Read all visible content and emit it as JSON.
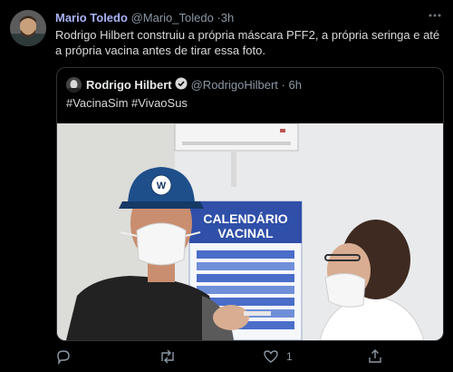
{
  "tweet": {
    "author_name": "Mario Toledo",
    "author_handle": "@Mario_Toledo",
    "separator": "·",
    "time": "3h",
    "text": "Rodrigo Hilbert construiu a própria máscara PFF2, a própria seringa e até a própria vacina antes de tirar essa foto."
  },
  "quoted_tweet": {
    "author_name": "Rodrigo Hilbert",
    "author_handle": "@RodrigoHilbert",
    "separator": "·",
    "time": "6h",
    "text": "#VacinaSim #VivaoSus",
    "image": {
      "poster_title_line1": "CALENDÁRIO",
      "poster_title_line2": "VACINAL",
      "cap_logo": "W"
    }
  },
  "actions": {
    "like_count": "1"
  },
  "icons": [
    "more-icon",
    "verified-icon",
    "reply-icon",
    "retweet-icon",
    "like-icon",
    "share-icon"
  ],
  "colors": {
    "author_name": "#a9b4f7",
    "muted": "#8b98a5",
    "background": "#000000",
    "border": "#2f3336",
    "verified": "#1d9bf0"
  }
}
